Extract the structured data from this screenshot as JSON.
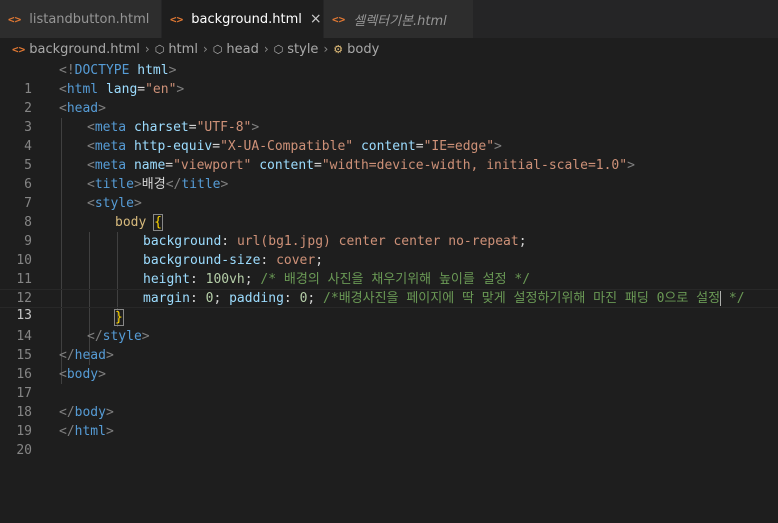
{
  "tabs": [
    {
      "label": "listandbutton.html",
      "active": false,
      "italic": false
    },
    {
      "label": "background.html",
      "active": true,
      "italic": false,
      "close": "×"
    },
    {
      "label": "셀렉터기본.html",
      "active": false,
      "italic": true
    }
  ],
  "breadcrumb": [
    "background.html",
    "html",
    "head",
    "style",
    "body"
  ],
  "current_line": 13,
  "lines": [
    {
      "n": "1"
    },
    {
      "n": "2"
    },
    {
      "n": "3"
    },
    {
      "n": "4"
    },
    {
      "n": "5"
    },
    {
      "n": "6"
    },
    {
      "n": "7"
    },
    {
      "n": "8"
    },
    {
      "n": "9"
    },
    {
      "n": "10"
    },
    {
      "n": "11"
    },
    {
      "n": "12"
    },
    {
      "n": "13"
    },
    {
      "n": "14"
    },
    {
      "n": "15"
    },
    {
      "n": "16"
    },
    {
      "n": "17"
    },
    {
      "n": "18"
    },
    {
      "n": "19"
    },
    {
      "n": "20"
    }
  ],
  "code": {
    "l1": {
      "open": "<!",
      "tag": "DOCTYPE",
      "rest": " html",
      "close": ">"
    },
    "l2": {
      "open": "<",
      "tag": "html",
      "attr": " lang",
      "eq": "=",
      "val": "\"en\"",
      "close": ">"
    },
    "l3": {
      "open": "<",
      "tag": "head",
      "close": ">"
    },
    "l4": {
      "open": "<",
      "tag": "meta",
      "attr": " charset",
      "eq": "=",
      "val": "\"UTF-8\"",
      "close": ">"
    },
    "l5": {
      "open": "<",
      "tag": "meta",
      "attr1": " http-equiv",
      "eq1": "=",
      "val1": "\"X-UA-Compatible\"",
      "attr2": " content",
      "eq2": "=",
      "val2": "\"IE=edge\"",
      "close": ">"
    },
    "l6": {
      "open": "<",
      "tag": "meta",
      "attr1": " name",
      "eq1": "=",
      "val1": "\"viewport\"",
      "attr2": " content",
      "eq2": "=",
      "val2": "\"width=device-width, initial-scale=1.0\"",
      "close": ">"
    },
    "l7": {
      "open": "<",
      "tag": "title",
      "close": ">",
      "text": "배경",
      "open2": "</",
      "tag2": "title",
      "close2": ">"
    },
    "l8": {
      "open": "<",
      "tag": "style",
      "close": ">"
    },
    "l9": {
      "sel": "body",
      "brace": "{"
    },
    "l10": {
      "prop": "background",
      "colon": ": ",
      "val": "url(bg1.jpg) center center no-repeat",
      "semi": ";"
    },
    "l11": {
      "prop": "background-size",
      "colon": ": ",
      "val": "cover",
      "semi": ";"
    },
    "l12": {
      "prop": "height",
      "colon": ": ",
      "num": "100vh",
      "semi": ";",
      "comment": " /* 배경의 사진을 채우기위해 높이를 설정 */"
    },
    "l13": {
      "prop1": "margin",
      "colon1": ": ",
      "num1": "0",
      "semi1": ";",
      "prop2": " padding",
      "colon2": ": ",
      "num2": "0",
      "semi2": ";",
      "comment_a": " /*배경사진을 페이지에 딱 맞게 설정하기위해 마진 패딩 0으로 설정",
      "comment_b": " */"
    },
    "l14": {
      "brace": "}"
    },
    "l15": {
      "open": "</",
      "tag": "style",
      "close": ">"
    },
    "l16": {
      "open": "</",
      "tag": "head",
      "close": ">"
    },
    "l17": {
      "open": "<",
      "tag": "body",
      "close": ">"
    },
    "l19": {
      "open": "</",
      "tag": "body",
      "close": ">"
    },
    "l20": {
      "open": "</",
      "tag": "html",
      "close": ">"
    }
  },
  "icons": {
    "html_file": "html-file-icon",
    "symbol": "symbol-cube-icon",
    "element": "element-icon",
    "close": "close-icon"
  },
  "colors": {
    "background": "#1e1e1e",
    "tag": "#569cd6",
    "attribute": "#9cdcfe",
    "string": "#ce9178",
    "comment": "#6a9955",
    "selector": "#d7ba7d",
    "number": "#b5cea8",
    "html_icon": "#e37933"
  }
}
